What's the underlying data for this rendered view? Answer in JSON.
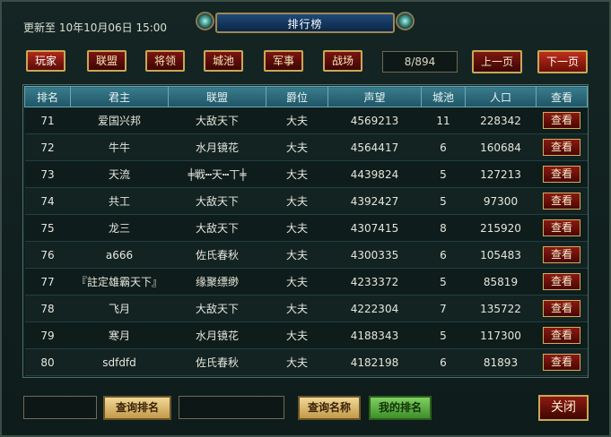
{
  "header": {
    "updated": "更新至 10年10月06日 15:00",
    "title": "排行榜"
  },
  "tabs": [
    {
      "label": "玩家",
      "active": true
    },
    {
      "label": "联盟",
      "active": false
    },
    {
      "label": "将领",
      "active": false
    },
    {
      "label": "城池",
      "active": false
    },
    {
      "label": "军事",
      "active": false
    },
    {
      "label": "战场",
      "active": false
    }
  ],
  "pagination": {
    "display": "8/894",
    "prev_label": "上一页",
    "next_label": "下一页"
  },
  "table": {
    "headers": [
      "排名",
      "君主",
      "联盟",
      "爵位",
      "声望",
      "城池",
      "人口",
      "查看"
    ],
    "view_label": "查看",
    "rows": [
      [
        "71",
        "爱国兴邦",
        "大敌天下",
        "大夫",
        "4569213",
        "11",
        "228342"
      ],
      [
        "72",
        "牛牛",
        "水月镜花",
        "大夫",
        "4564417",
        "6",
        "160684"
      ],
      [
        "73",
        "天流",
        "╪戦┅天┅丅╪",
        "大夫",
        "4439824",
        "5",
        "127213"
      ],
      [
        "74",
        "共工",
        "大敌天下",
        "大夫",
        "4392427",
        "5",
        "97300"
      ],
      [
        "75",
        "龙三",
        "大敌天下",
        "大夫",
        "4307415",
        "8",
        "215920"
      ],
      [
        "76",
        "a666",
        "佐氏春秋",
        "大夫",
        "4300335",
        "6",
        "105483"
      ],
      [
        "77",
        "『註定雄霸天下』",
        "缘聚缥缈",
        "大夫",
        "4233372",
        "5",
        "85819"
      ],
      [
        "78",
        "飞月",
        "大敌天下",
        "大夫",
        "4222304",
        "7",
        "135722"
      ],
      [
        "79",
        "寒月",
        "水月镜花",
        "大夫",
        "4188343",
        "5",
        "117300"
      ],
      [
        "80",
        "sdfdfd",
        "佐氏春秋",
        "大夫",
        "4182198",
        "6",
        "81893"
      ]
    ]
  },
  "bottom": {
    "rank_input_value": "",
    "query_rank_label": "查询排名",
    "name_input_value": "",
    "query_name_label": "查询名称",
    "my_rank_label": "我的排名",
    "close_label": "关闭"
  }
}
